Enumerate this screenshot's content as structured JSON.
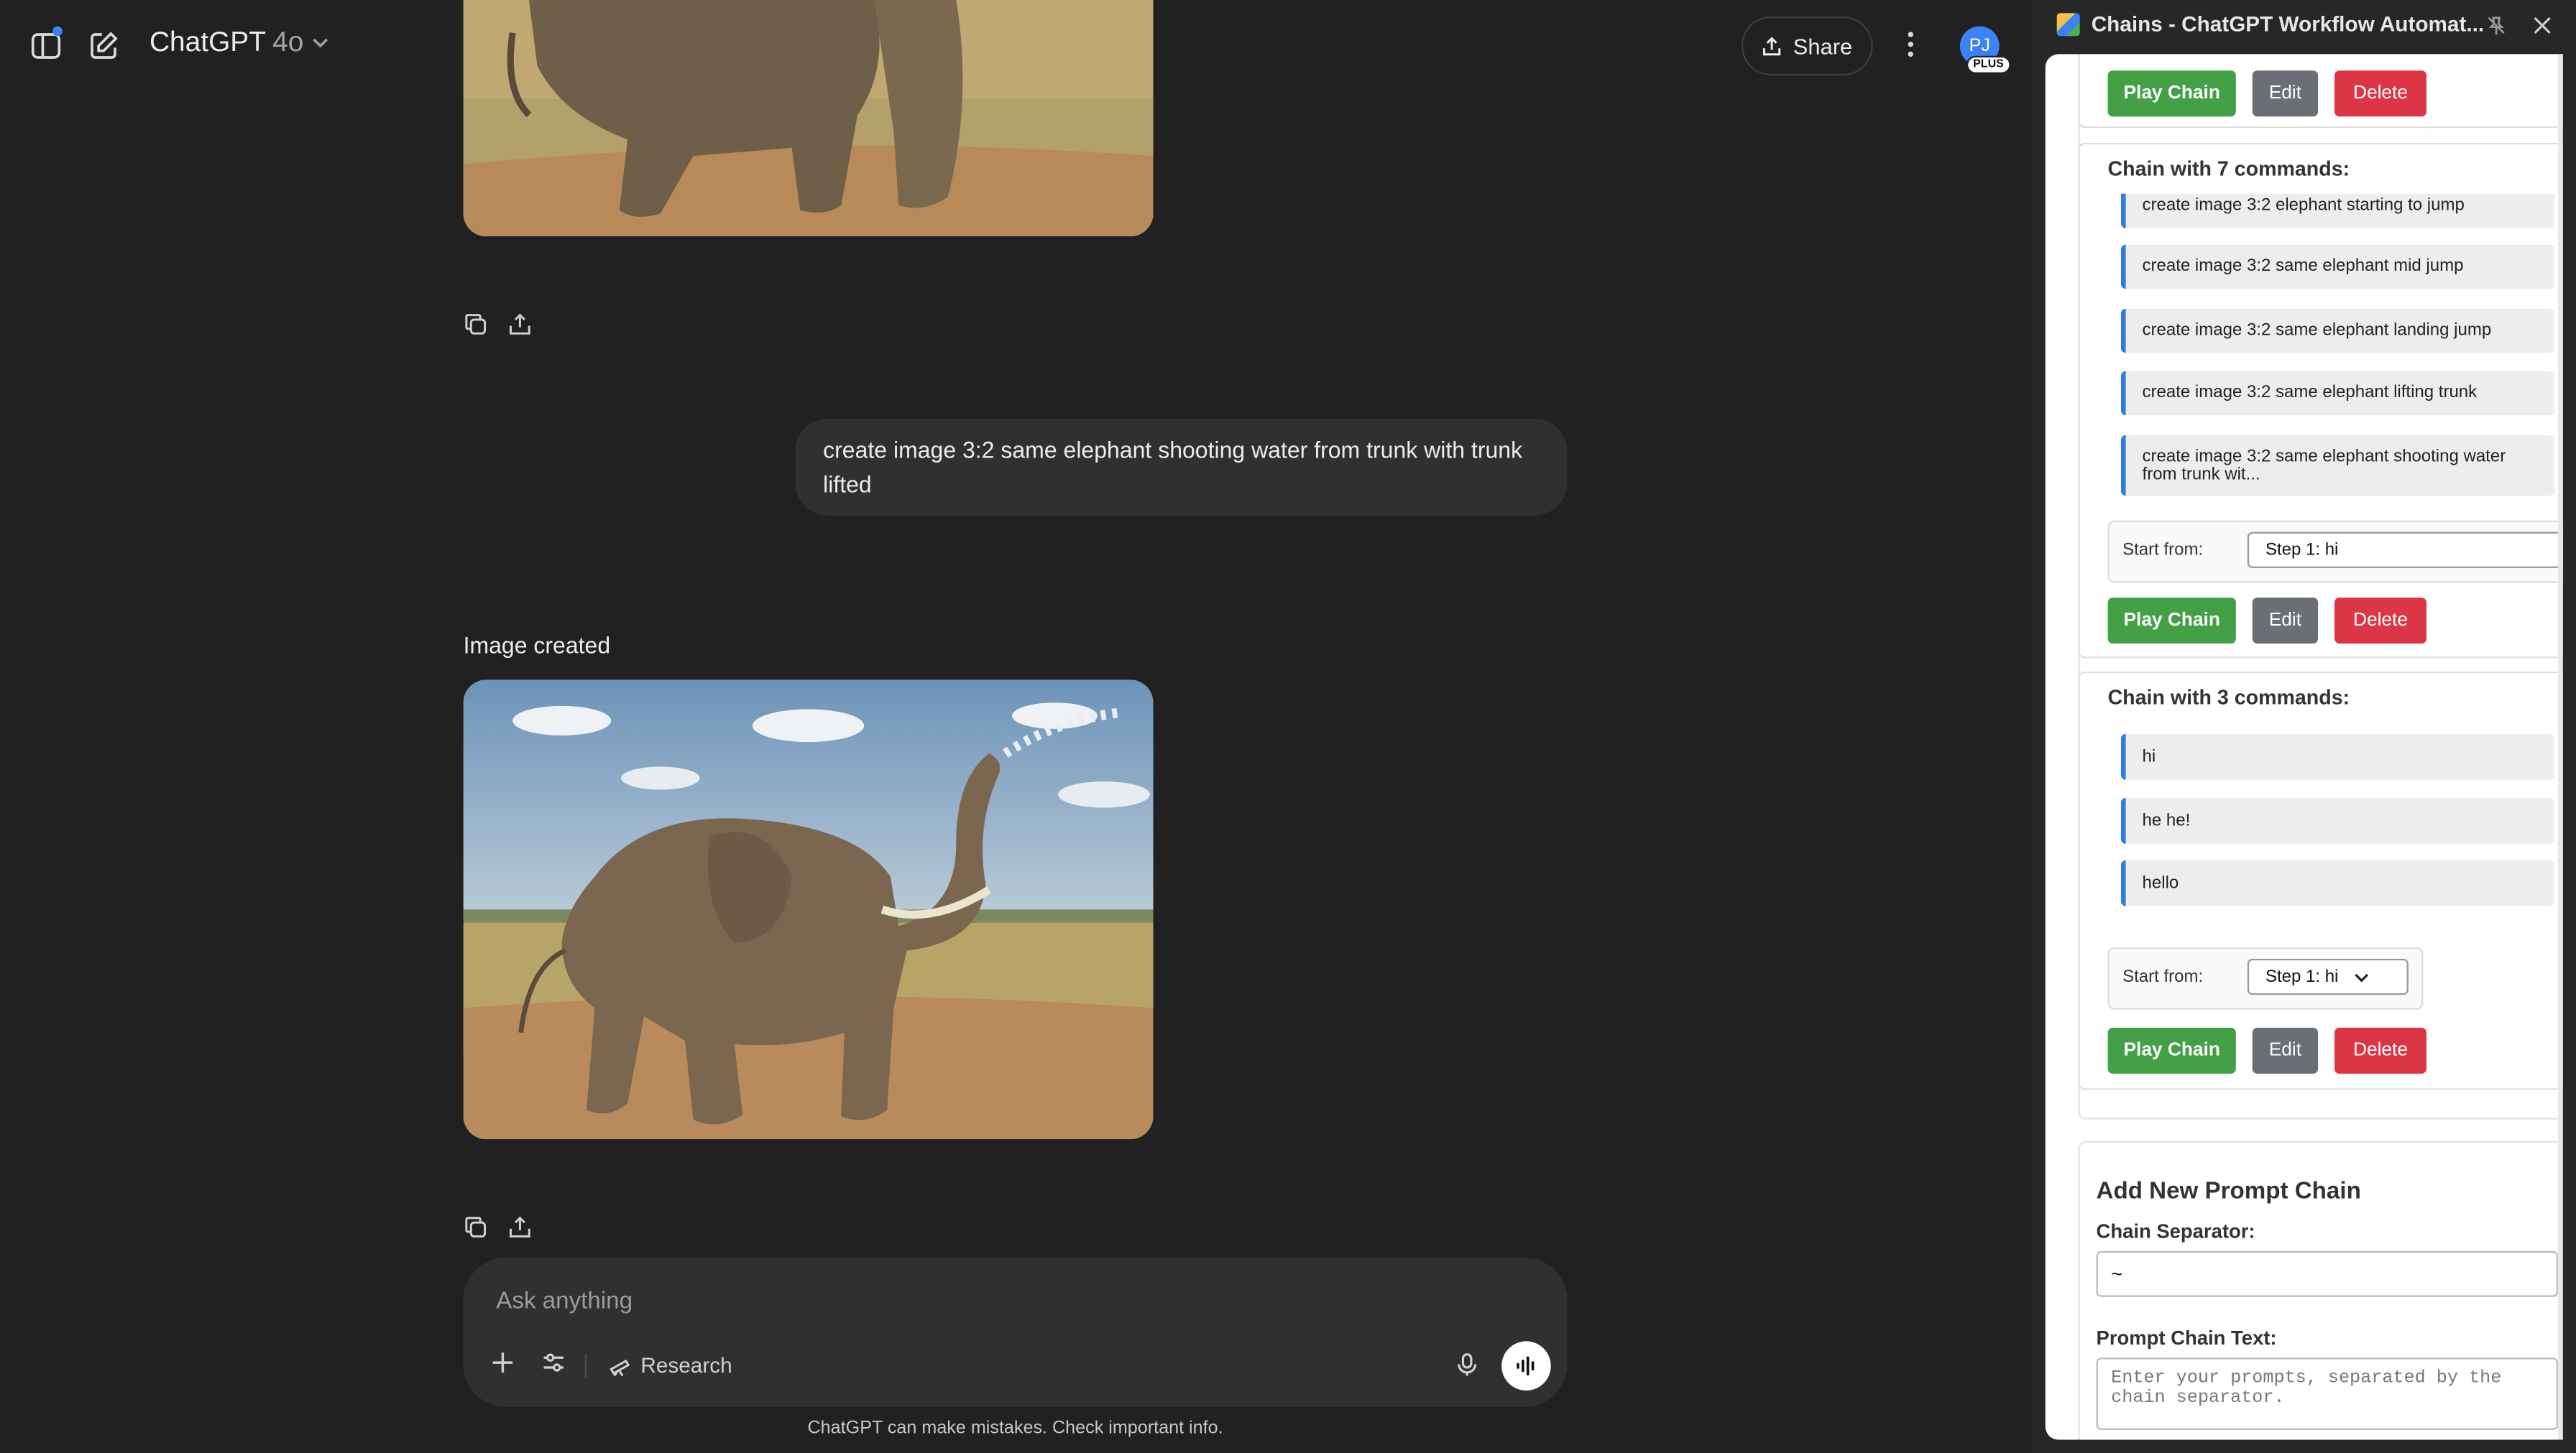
{
  "header": {
    "model_name": "ChatGPT",
    "model_version": "4o",
    "share_label": "Share",
    "avatar_initials": "PJ",
    "avatar_badge": "PLUS"
  },
  "conversation": {
    "user_message": "create image 3:2 same elephant shooting water from trunk with trunk lifted",
    "image_created_label": "Image created"
  },
  "composer": {
    "placeholder": "Ask anything",
    "research_label": "Research",
    "disclaimer": "ChatGPT can make mistakes. Check important info."
  },
  "panel": {
    "title": "Chains - ChatGPT Workflow Automat...",
    "play_label": "Play Chain",
    "edit_label": "Edit",
    "delete_label": "Delete",
    "start_from_label": "Start from:",
    "chains": [
      {
        "title": "Chain with 7 commands:",
        "commands": [
          "create image 3:2 elephant starting to jump",
          "create image 3:2 same elephant mid jump",
          "create image 3:2 same elephant landing jump",
          "create image 3:2 same elephant lifting trunk",
          "create image 3:2 same elephant shooting water from trunk wit..."
        ],
        "start_from": "Step 1: hi"
      },
      {
        "title": "Chain with 3 commands:",
        "commands": [
          "hi",
          "he he!",
          "hello"
        ],
        "start_from": "Step 1: hi"
      }
    ],
    "add_form": {
      "title": "Add New Prompt Chain",
      "separator_label": "Chain Separator:",
      "separator_value": "~",
      "text_label": "Prompt Chain Text:",
      "text_placeholder": "Enter your prompts, separated by the chain separator."
    }
  },
  "colors": {
    "background": "#212121",
    "play_button": "#43a047",
    "edit_button": "#6b6f75",
    "delete_button": "#dc3545",
    "command_accent": "#2f7de1",
    "avatar": "#3b82f6"
  }
}
